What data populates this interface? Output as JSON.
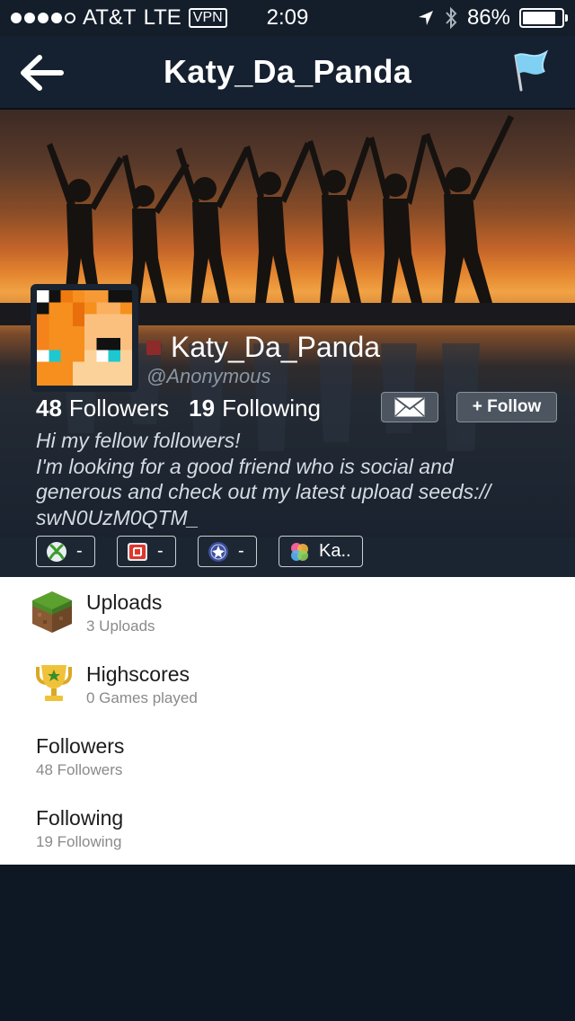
{
  "status_bar": {
    "carrier": "AT&T",
    "network": "LTE",
    "vpn": "VPN",
    "time": "2:09",
    "battery_text": "86%",
    "battery_level": 0.86,
    "signal_bars_filled": 4,
    "signal_bars_total": 5
  },
  "nav": {
    "title": "Katy_Da_Panda",
    "back_icon": "back-arrow-icon",
    "flag_icon": "flag-icon"
  },
  "profile": {
    "name": "Katy_Da_Panda",
    "handle": "@Anonymous",
    "status_color": "#8e2a2a",
    "followers_count": "48",
    "followers_label": "Followers",
    "following_count": "19",
    "following_label": "Following",
    "follow_button": "+ Follow",
    "bio_lines": [
      "Hi my fellow followers!",
      "I'm looking for a good friend who is social and",
      "generous and check out my latest upload seeds://",
      "swN0UzM0QTM_"
    ]
  },
  "badges": [
    {
      "icon": "xbox-icon",
      "label": "-"
    },
    {
      "icon": "nintendo-icon",
      "label": "-"
    },
    {
      "icon": "playstation-icon",
      "label": "-"
    },
    {
      "icon": "game-center-icon",
      "label": "Ka.."
    }
  ],
  "menu": [
    {
      "title": "Uploads",
      "subtitle": "3 Uploads",
      "icon": "grass-block-icon"
    },
    {
      "title": "Highscores",
      "subtitle": "0 Games played",
      "icon": "trophy-icon"
    },
    {
      "title": "Followers",
      "subtitle": "48 Followers"
    },
    {
      "title": "Following",
      "subtitle": "19 Following"
    }
  ]
}
